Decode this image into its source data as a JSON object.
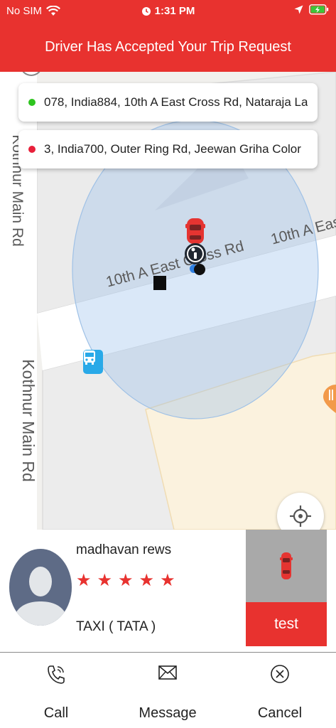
{
  "status_bar": {
    "carrier": "No SIM",
    "time": "1:31 PM",
    "icons": [
      "wifi-icon",
      "alarm-icon",
      "location-arrow-icon",
      "battery-charging-icon"
    ]
  },
  "header": {
    "title": "Driver Has Accepted Your Trip Request",
    "background": "#e8322f"
  },
  "map": {
    "pickup_address": "078, India884, 10th A East Cross Rd, Nataraja La",
    "pickup_color": "#2ec41f",
    "drop_address": "3, India700, Outer Ring Rd, Jeewan Griha Color",
    "drop_color": "#e8203a",
    "road_labels": {
      "kothnur_upper": "Kothnur Main Rd",
      "kothnur_lower": "Kothnur Main Rd",
      "cross_rd_center": "10th A East Cross Rd",
      "cross_rd_right": "10th A Eas"
    }
  },
  "driver": {
    "name": "madhavan rews",
    "rating": 5,
    "vehicle": "TAXI ( TATA )",
    "car_label": "test",
    "accent": "#e8322f"
  },
  "actions": {
    "call_label": "Call",
    "message_label": "Message",
    "cancel_label": "Cancel"
  }
}
